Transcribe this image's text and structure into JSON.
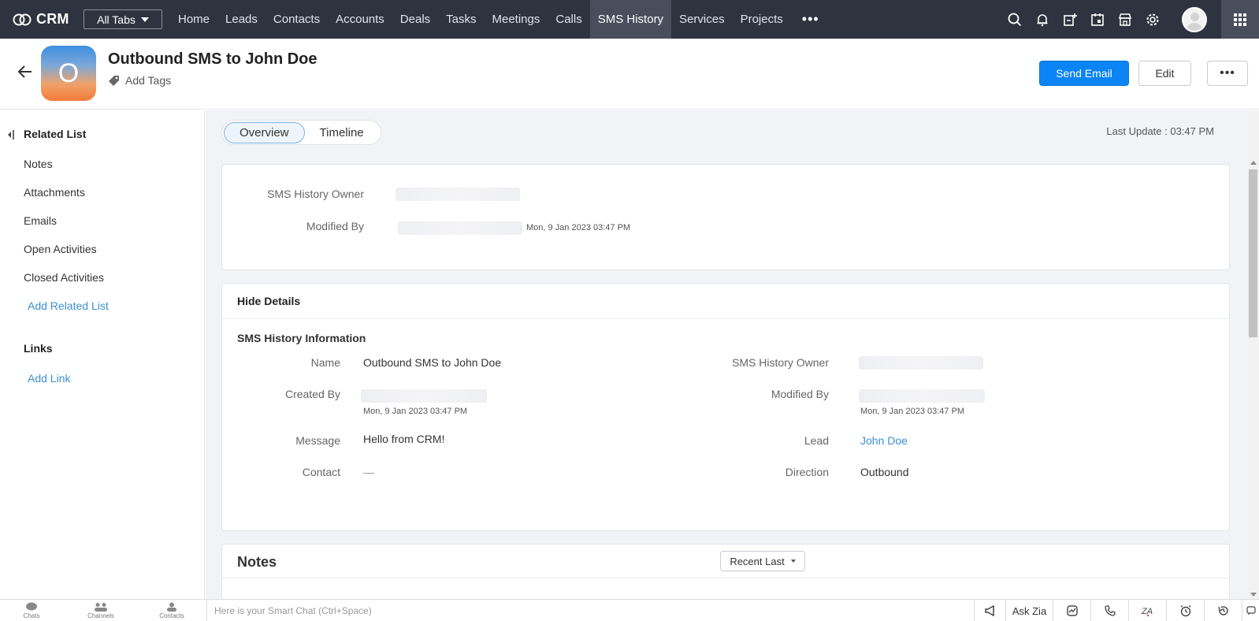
{
  "topbar": {
    "app_name": "CRM",
    "all_tabs_label": "All Tabs",
    "tabs": [
      {
        "label": "Home"
      },
      {
        "label": "Leads"
      },
      {
        "label": "Contacts"
      },
      {
        "label": "Accounts"
      },
      {
        "label": "Deals"
      },
      {
        "label": "Tasks"
      },
      {
        "label": "Meetings"
      },
      {
        "label": "Calls"
      },
      {
        "label": "SMS History"
      },
      {
        "label": "Services"
      },
      {
        "label": "Projects"
      }
    ],
    "more_label": "•••",
    "active_tab": "SMS History",
    "icons": [
      "search-icon",
      "bell-icon",
      "add-entry-icon",
      "calendar-icon",
      "marketplace-icon",
      "gear-icon"
    ]
  },
  "record": {
    "avatar_letter": "O",
    "title": "Outbound SMS to John Doe",
    "add_tags_label": "Add Tags",
    "send_email_label": "Send Email",
    "edit_label": "Edit",
    "more_label": "•••"
  },
  "sidebar": {
    "related_list_heading": "Related List",
    "related_items": [
      "Notes",
      "Attachments",
      "Emails",
      "Open Activities",
      "Closed Activities"
    ],
    "add_related_list_label": "Add Related List",
    "links_heading": "Links",
    "add_link_label": "Add Link"
  },
  "main": {
    "tabs": {
      "overview": "Overview",
      "timeline": "Timeline"
    },
    "last_update": "Last Update : 03:47 PM",
    "summary": {
      "owner_label": "SMS History Owner",
      "modified_by_label": "Modified By",
      "modified_time": "Mon, 9 Jan 2023 03:47 PM"
    },
    "details": {
      "hide_details_label": "Hide Details",
      "section_title": "SMS History Information",
      "name_label": "Name",
      "name_value": "Outbound SMS to John Doe",
      "created_by_label": "Created By",
      "created_time": "Mon, 9 Jan 2023 03:47 PM",
      "message_label": "Message",
      "message_value": "Hello from CRM!",
      "contact_label": "Contact",
      "contact_value": "—",
      "owner_label": "SMS History Owner",
      "modified_by_label": "Modified By",
      "modified_time": "Mon, 9 Jan 2023 03:47 PM",
      "lead_label": "Lead",
      "lead_value": "John Doe",
      "direction_label": "Direction",
      "direction_value": "Outbound"
    },
    "notes": {
      "title": "Notes",
      "sort_label": "Recent Last"
    }
  },
  "bottombar": {
    "chats_label": "Chats",
    "channels_label": "Channels",
    "contacts_label": "Contacts",
    "smart_chat_placeholder": "Here is your Smart Chat (Ctrl+Space)",
    "ask_zia_label": "Ask Zia"
  },
  "colors": {
    "topbar_bg": "#2f3340",
    "primary_button": "#0b84f5",
    "link": "#3c8fd4"
  }
}
